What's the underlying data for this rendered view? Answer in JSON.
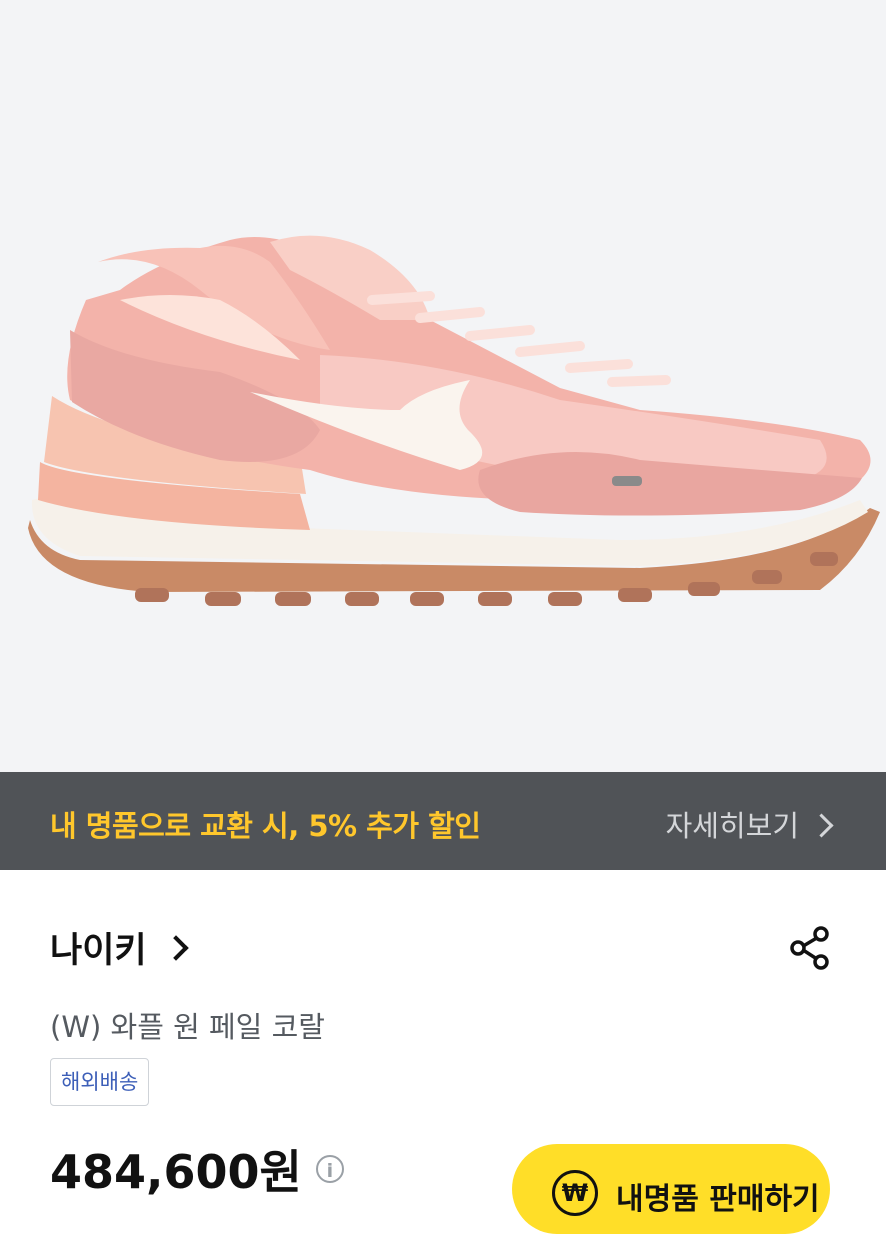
{
  "promo": {
    "text": "내 명품으로 교환 시, 5% 추가 할인",
    "more_label": "자세히보기"
  },
  "product": {
    "brand": "나이키",
    "name": "(W) 와플 원 페일 코랄",
    "badge": "해외배송",
    "price": "484,600원",
    "info_glyph": "i"
  },
  "sell_button": {
    "icon_glyph": "₩",
    "label": "내명품 판매하기"
  },
  "icons": [
    "chevron-right-icon",
    "share-icon",
    "info-icon",
    "won-icon"
  ],
  "colors": {
    "promo_bg": "#505357",
    "promo_accent": "#ffc72c",
    "badge_text": "#3d5fb8",
    "sell_button_bg": "#ffde28"
  }
}
